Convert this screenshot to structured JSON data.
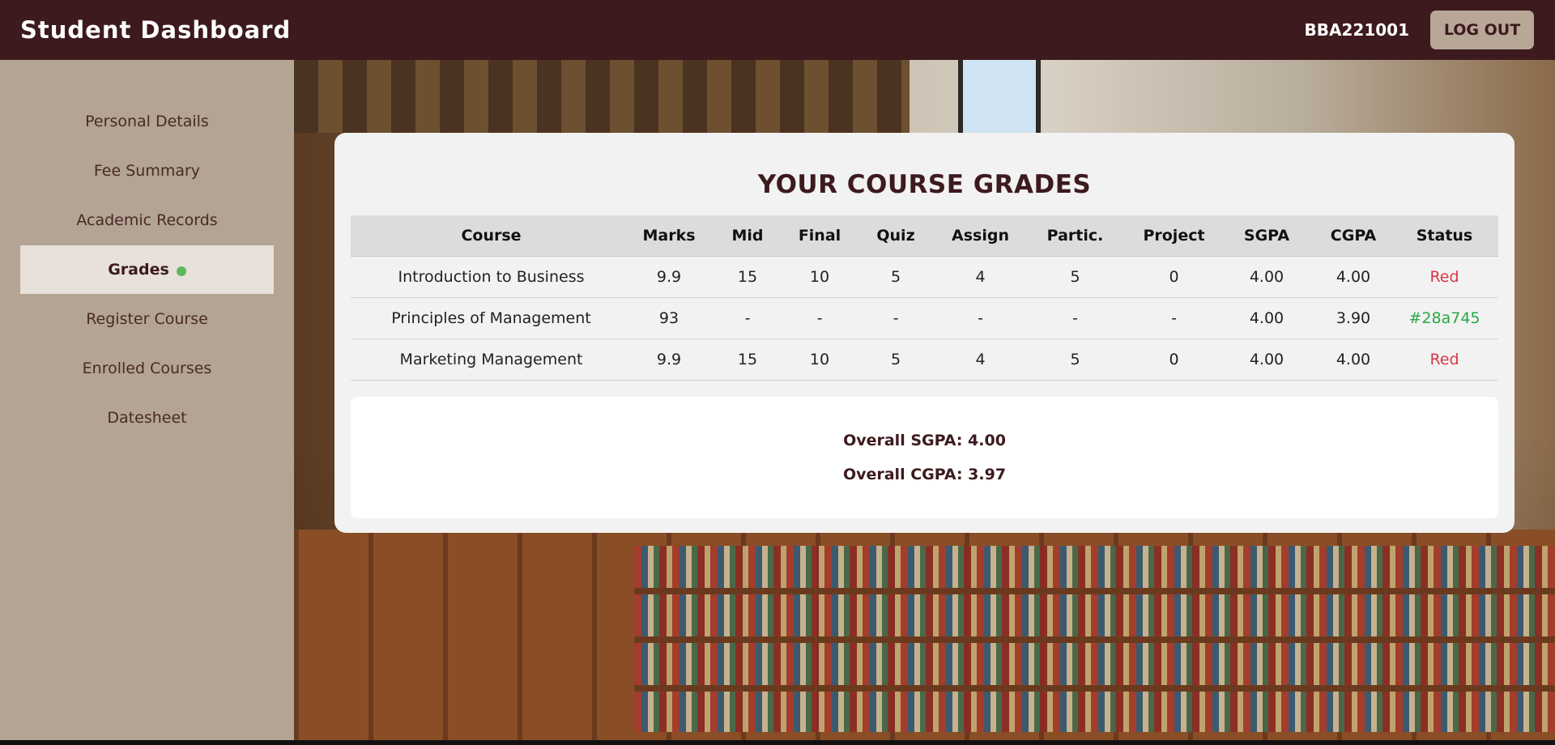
{
  "header": {
    "title": "Student Dashboard",
    "user_id": "BBA221001",
    "logout_label": "LOG OUT"
  },
  "sidebar": {
    "items": [
      {
        "label": "Personal Details"
      },
      {
        "label": "Fee Summary"
      },
      {
        "label": "Academic Records"
      },
      {
        "label": "Grades",
        "active": true
      },
      {
        "label": "Register Course"
      },
      {
        "label": "Enrolled Courses"
      },
      {
        "label": "Datesheet"
      }
    ]
  },
  "grades": {
    "title": "YOUR COURSE GRADES",
    "columns": [
      "Course",
      "Marks",
      "Mid",
      "Final",
      "Quiz",
      "Assign",
      "Partic.",
      "Project",
      "SGPA",
      "CGPA",
      "Status"
    ],
    "rows": [
      [
        "Introduction to Business",
        "9.9",
        "15",
        "10",
        "5",
        "4",
        "5",
        "0",
        "4.00",
        "4.00",
        "Red"
      ],
      [
        "Principles of Management",
        "93",
        "-",
        "-",
        "-",
        "-",
        "-",
        "-",
        "4.00",
        "3.90",
        "#28a745"
      ],
      [
        "Marketing Management",
        "9.9",
        "15",
        "10",
        "5",
        "4",
        "5",
        "0",
        "4.00",
        "4.00",
        "Red"
      ]
    ],
    "status_colors": {
      "Red": "#dc3545",
      "#28a745": "#28a745"
    }
  },
  "summary": {
    "sgpa": "Overall SGPA: 4.00",
    "cgpa": "Overall CGPA: 3.97"
  },
  "colors": {
    "header_bg": "#3d1a1d",
    "sidebar_bg": "#b3a494",
    "active_item_bg": "#e7e1da",
    "active_dot": "#5cb85c"
  }
}
